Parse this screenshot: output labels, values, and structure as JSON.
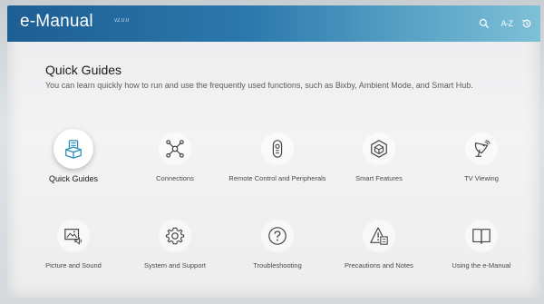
{
  "header": {
    "app_title": "e-Manual",
    "version": "v2.0.0",
    "search_icon": "search-icon",
    "az_label": "A-Z",
    "history_icon": "history-icon"
  },
  "section": {
    "title": "Quick Guides",
    "description": "You can learn quickly how to run and use the frequently used functions, such as Bixby, Ambient Mode, and Smart Hub."
  },
  "categories": [
    {
      "label": "Quick Guides",
      "icon": "quick-guides-icon",
      "selected": true
    },
    {
      "label": "Connections",
      "icon": "connections-icon"
    },
    {
      "label": "Remote Control and Peripherals",
      "icon": "remote-control-icon"
    },
    {
      "label": "Smart Features",
      "icon": "smart-features-icon"
    },
    {
      "label": "TV Viewing",
      "icon": "tv-viewing-icon"
    },
    {
      "label": "Picture and Sound",
      "icon": "picture-sound-icon"
    },
    {
      "label": "System and Support",
      "icon": "system-support-icon"
    },
    {
      "label": "Troubleshooting",
      "icon": "troubleshooting-icon"
    },
    {
      "label": "Precautions and Notes",
      "icon": "precautions-icon"
    },
    {
      "label": "Using the e-Manual",
      "icon": "e-manual-book-icon"
    }
  ],
  "colors": {
    "header_start": "#1d5e93",
    "header_end": "#7fc0d6",
    "icon_accent": "#2a8fb8"
  }
}
